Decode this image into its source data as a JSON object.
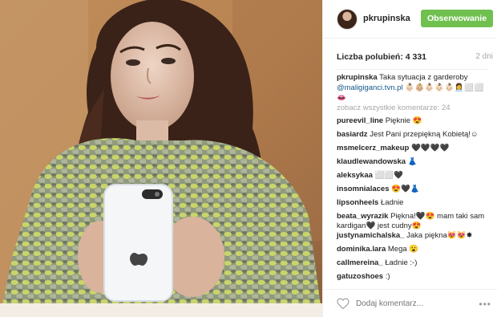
{
  "post": {
    "username": "pkrupinska",
    "follow_label": "Obserwowanie",
    "likes": "Liczba polubień: 4 331",
    "age": "2 dni",
    "caption": {
      "user": "pkrupinska",
      "text": "Taka sytuacja z garderoby",
      "link": "@maligiganci.tvn.pl",
      "emoji": "👶🏻👶🏼👶🏻👶🏻👶🏻👩‍💼⬜⬜👄"
    },
    "view_all": "zobacz wszystkie komentarze: 24"
  },
  "comments": [
    {
      "user": "pureevil_line",
      "text": "Pięknie 😍"
    },
    {
      "user": "basiardz",
      "text": "Jest Pani przepiękną Kobietą!☺"
    },
    {
      "user": "msmelcerz_makeup",
      "text": "🖤🖤🖤🖤"
    },
    {
      "user": "klaudlewandowska",
      "text": "👗"
    },
    {
      "user": "aleksykaa",
      "text": "⬜⬜🖤"
    },
    {
      "user": "insomnialaces",
      "text": "😍🖤👗"
    },
    {
      "user": "lipsonheels",
      "text": "Ładnie"
    },
    {
      "user": "beata_wyrazik",
      "text": "Piękna!🖤😍 mam taki sam kardigan🖤 jest cudny😍"
    },
    {
      "user": "justynamichalska_",
      "text": "Jaka piękna😻😻✸"
    },
    {
      "user": "dominika.lara",
      "text": "Mega 😮"
    },
    {
      "user": "callmereina_",
      "text": "Ładnie :-)"
    },
    {
      "user": "gatuzoshoes",
      "text": ":)"
    }
  ],
  "footer": {
    "add_comment_placeholder": "Dodaj komentarz...",
    "more_label": "•••"
  },
  "colors": {
    "follow_green": "#70c050",
    "link_blue": "#125688",
    "muted_gray": "#a5a7aa"
  },
  "icons": {
    "like": "heart-icon",
    "more": "more-options-icon"
  }
}
